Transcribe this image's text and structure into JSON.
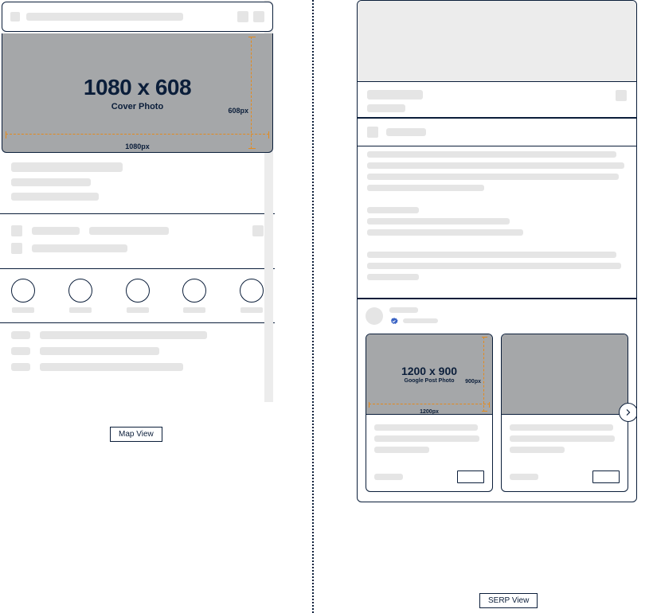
{
  "left": {
    "cover": {
      "title": "1080 x 608",
      "subtitle": "Cover Photo",
      "height_label": "608px",
      "width_label": "1080px"
    },
    "view_label": "Map View"
  },
  "right": {
    "post_photo": {
      "title": "1200 x 900",
      "subtitle": "Google Post Photo",
      "height_label": "900px",
      "width_label": "1200px"
    },
    "view_label": "SERP View"
  }
}
